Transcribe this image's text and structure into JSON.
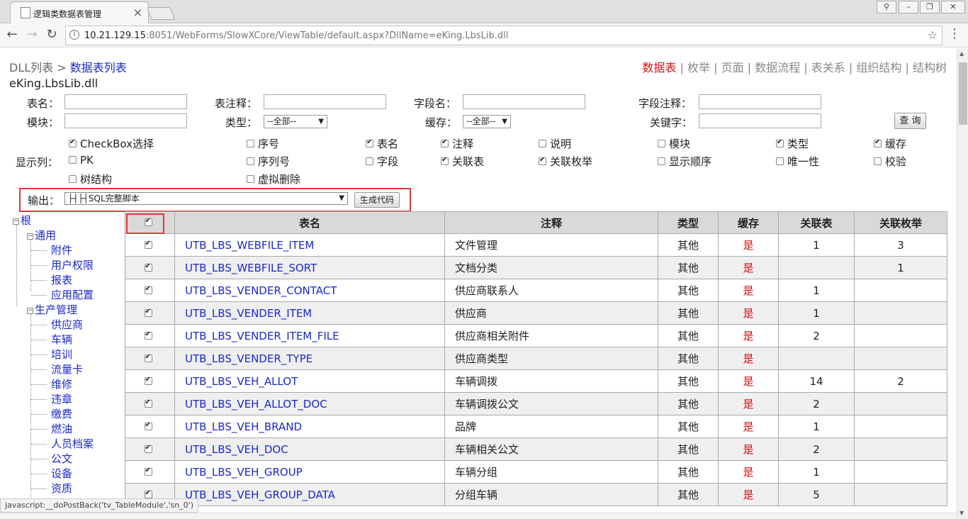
{
  "browser": {
    "tab_title": "逻辑类数据表管理",
    "url_host": "10.21.129.15",
    "url_rest": ":8051/WebForms/SlowXCore/ViewTable/default.aspx?DllName=eKing.LbsLib.dll",
    "status_text": "javascript:__doPostBack('tv_TableModule','sn_0')"
  },
  "breadcrumb": {
    "root": "DLL列表",
    "sep": ">",
    "current": "数据表列表"
  },
  "dll_name": "eKing.LbsLib.dll",
  "topnav": {
    "items": [
      "数据表",
      "枚举",
      "页面",
      "数据流程",
      "表关系",
      "组织结构",
      "结构树"
    ],
    "active": "数据表",
    "sep": "|"
  },
  "filters": {
    "table_name_label": "表名：",
    "table_comment_label": "表注释：",
    "field_name_label": "字段名：",
    "field_comment_label": "字段注释：",
    "module_label": "模块：",
    "type_label": "类型：",
    "type_value": "--全部--",
    "cache_label": "缓存：",
    "cache_value": "--全部--",
    "keyword_label": "关键字：",
    "query_button": "查 询"
  },
  "show_columns": {
    "label": "显示列：",
    "items": [
      {
        "label": "CheckBox选择",
        "checked": true
      },
      {
        "label": "序号",
        "checked": false
      },
      {
        "label": "表名",
        "checked": true
      },
      {
        "label": "注释",
        "checked": true
      },
      {
        "label": "说明",
        "checked": false
      },
      {
        "label": "模块",
        "checked": false
      },
      {
        "label": "类型",
        "checked": true
      },
      {
        "label": "缓存",
        "checked": true
      },
      {
        "label": "PK",
        "checked": false
      },
      {
        "label": "序列号",
        "checked": false
      },
      {
        "label": "字段",
        "checked": false
      },
      {
        "label": "关联表",
        "checked": true
      },
      {
        "label": "关联枚举",
        "checked": true
      },
      {
        "label": "显示顺序",
        "checked": false
      },
      {
        "label": "唯一性",
        "checked": false
      },
      {
        "label": "校验",
        "checked": false
      },
      {
        "label": "树结构",
        "checked": false
      },
      {
        "label": "虚拟删除",
        "checked": false
      }
    ]
  },
  "output": {
    "label": "输出：",
    "selected": "├┤├┤SQL完整脚本",
    "generate_button": "生成代码"
  },
  "tree": {
    "root": "根",
    "group1": "通用",
    "group1_items": [
      "附件",
      "用户权限",
      "报表",
      "应用配置"
    ],
    "group2": "生产管理",
    "group2_items": [
      "供应商",
      "车辆",
      "培训",
      "流量卡",
      "维修",
      "违章",
      "缴费",
      "燃油",
      "人员档案",
      "公文",
      "设备",
      "资质"
    ]
  },
  "grid": {
    "headers": [
      "",
      "表名",
      "注释",
      "类型",
      "缓存",
      "关联表",
      "关联枚举"
    ],
    "rows": [
      {
        "name": "UTB_LBS_WEBFILE_ITEM",
        "comment": "文件管理",
        "type": "其他",
        "cache": "是",
        "rel": "1",
        "enum": "3"
      },
      {
        "name": "UTB_LBS_WEBFILE_SORT",
        "comment": "文档分类",
        "type": "其他",
        "cache": "是",
        "rel": "",
        "enum": "1"
      },
      {
        "name": "UTB_LBS_VENDER_CONTACT",
        "comment": "供应商联系人",
        "type": "其他",
        "cache": "是",
        "rel": "1",
        "enum": ""
      },
      {
        "name": "UTB_LBS_VENDER_ITEM",
        "comment": "供应商",
        "type": "其他",
        "cache": "是",
        "rel": "1",
        "enum": ""
      },
      {
        "name": "UTB_LBS_VENDER_ITEM_FILE",
        "comment": "供应商相关附件",
        "type": "其他",
        "cache": "是",
        "rel": "2",
        "enum": ""
      },
      {
        "name": "UTB_LBS_VENDER_TYPE",
        "comment": "供应商类型",
        "type": "其他",
        "cache": "是",
        "rel": "",
        "enum": ""
      },
      {
        "name": "UTB_LBS_VEH_ALLOT",
        "comment": "车辆调拨",
        "type": "其他",
        "cache": "是",
        "rel": "14",
        "enum": "2"
      },
      {
        "name": "UTB_LBS_VEH_ALLOT_DOC",
        "comment": "车辆调拨公文",
        "type": "其他",
        "cache": "是",
        "rel": "2",
        "enum": ""
      },
      {
        "name": "UTB_LBS_VEH_BRAND",
        "comment": "品牌",
        "type": "其他",
        "cache": "是",
        "rel": "1",
        "enum": ""
      },
      {
        "name": "UTB_LBS_VEH_DOC",
        "comment": "车辆相关公文",
        "type": "其他",
        "cache": "是",
        "rel": "2",
        "enum": ""
      },
      {
        "name": "UTB_LBS_VEH_GROUP",
        "comment": "车辆分组",
        "type": "其他",
        "cache": "是",
        "rel": "1",
        "enum": ""
      },
      {
        "name": "UTB_LBS_VEH_GROUP_DATA",
        "comment": "分组车辆",
        "type": "其他",
        "cache": "是",
        "rel": "5",
        "enum": ""
      }
    ]
  }
}
